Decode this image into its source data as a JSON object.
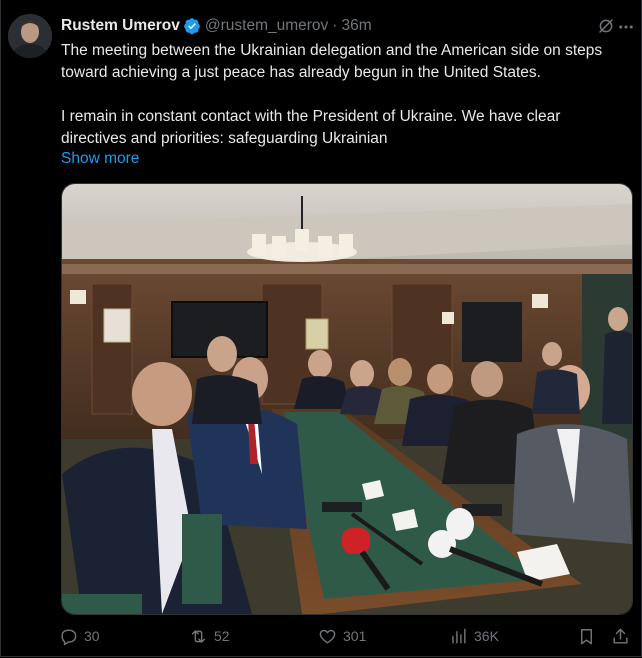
{
  "post": {
    "author_name": "Rustem Umerov",
    "handle": "@rustem_umerov",
    "time_sep": "·",
    "time": "36m",
    "paragraphs": [
      "The meeting between the Ukrainian delegation and the American side on steps toward achieving a just peace has already begun in the United States.",
      "I remain in constant contact with the President of Ukraine. We have clear directives and priorities: safeguarding Ukrainian"
    ],
    "show_more": "Show more"
  },
  "actions": {
    "replies": "30",
    "reposts": "52",
    "likes": "301",
    "views": "36K"
  },
  "colors": {
    "background": "#000000",
    "text": "#e7e9ea",
    "muted": "#71767b",
    "link": "#1d9bf0",
    "verified": "#1d9bf0"
  },
  "icons": [
    "verified-badge-icon",
    "grok-icon",
    "more-icon",
    "reply-icon",
    "repost-icon",
    "like-icon",
    "views-icon",
    "bookmark-icon",
    "share-icon"
  ]
}
